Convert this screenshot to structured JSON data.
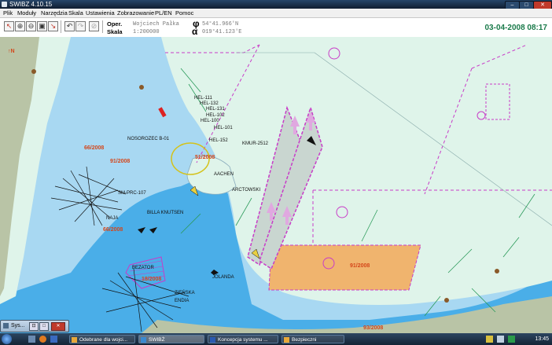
{
  "window": {
    "title": "SWIBZ 4.10.15"
  },
  "menu": [
    "Plik",
    "Moduły",
    "Narzędzia",
    "Skala",
    "Ustawienia",
    "Zobrazowanie",
    "PL/EN",
    "Pomoc"
  ],
  "header": {
    "oper_label": "Oper.",
    "oper_value": "Wojciech Pałka",
    "skala_label": "Skala",
    "skala_value": "1:200000",
    "phi_symbol": "φ",
    "phi_value": "54°41.966'N",
    "alpha_symbol": "α",
    "alpha_value": "019°41.123'E",
    "datetime": "03-04-2008 08:17"
  },
  "map": {
    "labels": {
      "hel111": "HEL-111",
      "hel132": "HEL-132",
      "hel131": "HEL-131",
      "hel102": "HEL-102",
      "hel101": "HEL-101",
      "hel152": "HEL-152",
      "hel100": "HEL-100",
      "nosorozec": "NOSOROZEC B-01",
      "kmur": "KMUR-2512",
      "aachen": "AACHEN",
      "arctowski": "ARCTOWSKI",
      "smprc": "SM-PRC-107",
      "knutsen": "BILLA KNUTSEN",
      "naja": "NAJA",
      "ezator": "BEZATOR",
      "jolanda": "JOLANDA",
      "zienska": "ZIEŃSKA",
      "endia": "ENDIA"
    },
    "zones": {
      "z66a": "66/2008",
      "z91a": "91/2008",
      "z51": "51/2008",
      "z66b": "66/2008",
      "z91b": "91/2008",
      "z93": "93/2008",
      "z18": "18/2008"
    },
    "colors": {
      "deep_water": "#4aaee8",
      "shallow_water": "#a8d8f2",
      "land": "#dff4ea",
      "coast": "#b9c4a6",
      "zone_fill": "#f0b46e",
      "zone_border": "#c83cc8"
    }
  },
  "minimized": {
    "label": "Sys..."
  },
  "taskbar": {
    "items": [
      "Odebrane dla wojci...",
      "SWIBŻ",
      "Koncepcja systemu ...",
      "Bezpieczni"
    ],
    "clock": "13:45"
  }
}
